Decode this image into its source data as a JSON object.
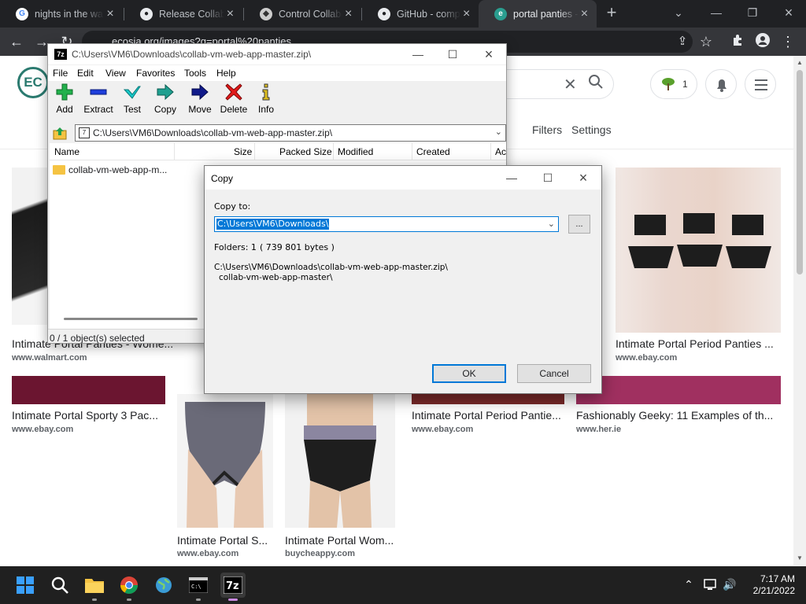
{
  "browser": {
    "tabs": [
      {
        "title": "nights in the wa",
        "favicon": "google-icon"
      },
      {
        "title": "Release CollabV",
        "favicon": "github-icon"
      },
      {
        "title": "Control Collabo",
        "favicon": "collabvm-icon"
      },
      {
        "title": "GitHub - compu",
        "favicon": "github-icon"
      },
      {
        "title": "portal panties -",
        "favicon": "ecosia-icon",
        "active": true
      }
    ],
    "url": "ecosia.org/images?q=portal%20panties"
  },
  "ecosia": {
    "logo_text": "EC",
    "tree_count": "1",
    "nav": {
      "filters": "Filters",
      "settings": "Settings"
    },
    "results": [
      {
        "caption": "Intimate Portal Panties - Wome...",
        "source": "www.walmart.com"
      },
      {
        "caption": "Intimate Portal Period Panties ...",
        "source": "www.ebay.com"
      },
      {
        "caption": "Intimate Portal Sporty 3 Pac...",
        "source": "www.ebay.com"
      },
      {
        "caption": "Intimate Portal Period Pantie...",
        "source": "www.ebay.com"
      },
      {
        "caption": "Fashionably Geeky: 11 Examples of th...",
        "source": "www.her.ie"
      },
      {
        "caption": "Intimate Portal S...",
        "source": "www.ebay.com"
      },
      {
        "caption": "Intimate Portal Wom...",
        "source": "buycheappy.com"
      }
    ]
  },
  "sevenzip": {
    "logo_text": "7z",
    "title": "C:\\Users\\VM6\\Downloads\\collab-vm-web-app-master.zip\\",
    "menu": [
      "File",
      "Edit",
      "View",
      "Favorites",
      "Tools",
      "Help"
    ],
    "tools": [
      {
        "label": "Add",
        "icon": "plus-icon"
      },
      {
        "label": "Extract",
        "icon": "minus-icon"
      },
      {
        "label": "Test",
        "icon": "check-icon"
      },
      {
        "label": "Copy",
        "icon": "copy-arrow-icon"
      },
      {
        "label": "Move",
        "icon": "move-arrow-icon"
      },
      {
        "label": "Delete",
        "icon": "delete-x-icon"
      },
      {
        "label": "Info",
        "icon": "info-icon"
      }
    ],
    "address": "C:\\Users\\VM6\\Downloads\\collab-vm-web-app-master.zip\\",
    "columns": [
      "Name",
      "Size",
      "Packed Size",
      "Modified",
      "Created",
      "Ac"
    ],
    "rows": [
      {
        "name": "collab-vm-web-app-m..."
      }
    ],
    "status": "0 / 1 object(s) selected"
  },
  "copy_dialog": {
    "title": "Copy",
    "copy_to_label": "Copy to:",
    "copy_to_value": "C:\\Users\\VM6\\Downloads\\",
    "browse_label": "...",
    "folders_label": "Folders: 1",
    "bytes_label": "( 739 801 bytes )",
    "path_line1": "C:\\Users\\VM6\\Downloads\\collab-vm-web-app-master.zip\\",
    "path_line2": "collab-vm-web-app-master\\",
    "ok_label": "OK",
    "cancel_label": "Cancel"
  },
  "taskbar": {
    "apps": [
      "start",
      "search",
      "file-explorer",
      "chrome",
      "network-globe",
      "terminal",
      "7zip"
    ],
    "terminal_text": "C:\\",
    "time": "7:17 AM",
    "date": "2/21/2022"
  },
  "colors": {
    "accent": "#0078d7",
    "ecosia_green": "#2a7a6f",
    "taskbar": "#202020"
  }
}
